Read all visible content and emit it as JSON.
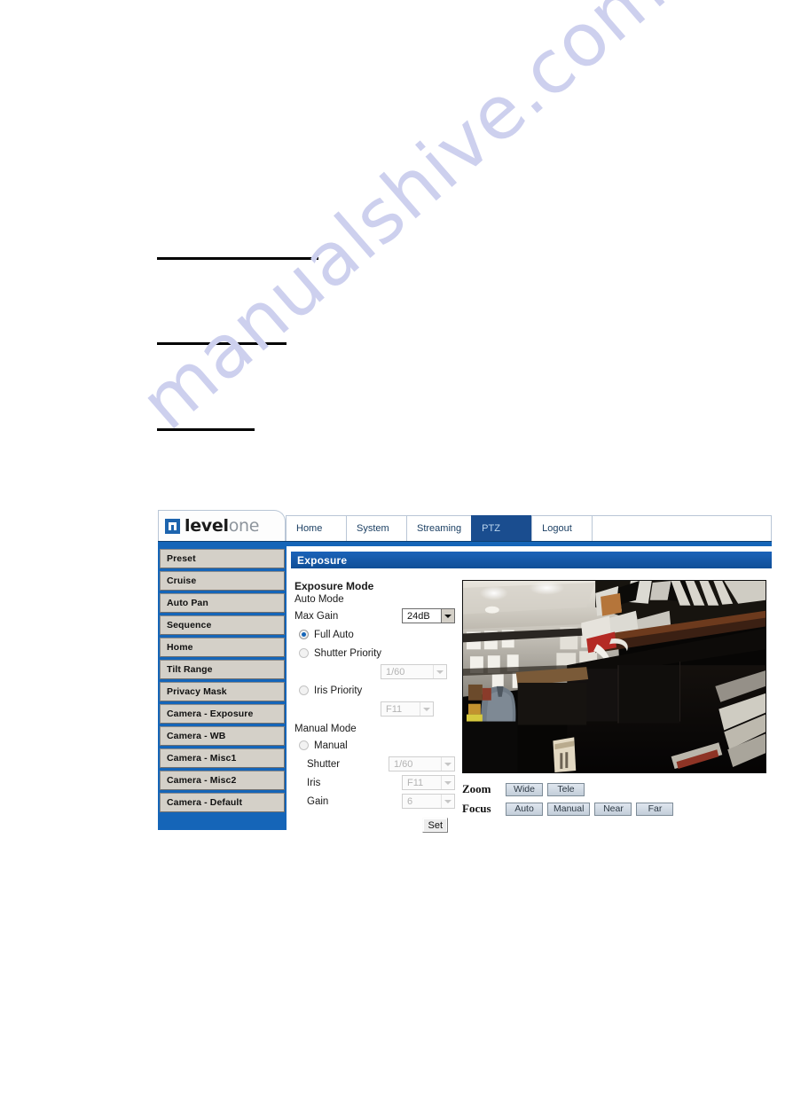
{
  "watermark": {
    "text": "manualshive.com"
  },
  "browser_ui": {
    "logo": {
      "brand_bold": "level",
      "brand_light": "one"
    },
    "tabs": [
      {
        "label": "Home",
        "active": false
      },
      {
        "label": "System",
        "active": false
      },
      {
        "label": "Streaming",
        "active": false
      },
      {
        "label": "PTZ",
        "active": true
      },
      {
        "label": "Logout",
        "active": false
      }
    ],
    "sidebar": {
      "items": [
        {
          "label": "Preset"
        },
        {
          "label": "Cruise"
        },
        {
          "label": "Auto Pan"
        },
        {
          "label": "Sequence"
        },
        {
          "label": "Home"
        },
        {
          "label": "Tilt Range"
        },
        {
          "label": "Privacy Mask"
        },
        {
          "label": "Camera - Exposure"
        },
        {
          "label": "Camera - WB"
        },
        {
          "label": "Camera - Misc1"
        },
        {
          "label": "Camera - Misc2"
        },
        {
          "label": "Camera - Default"
        }
      ]
    },
    "panel": {
      "title": "Exposure",
      "exposure_mode_heading": "Exposure Mode",
      "auto_mode_label": "Auto Mode",
      "max_gain_label": "Max Gain",
      "max_gain_value": "24dB",
      "full_auto_label": "Full Auto",
      "shutter_priority_label": "Shutter Priority",
      "shutter_priority_value": "1/60",
      "iris_priority_label": "Iris Priority",
      "iris_priority_value": "F11",
      "manual_mode_label": "Manual Mode",
      "manual_label": "Manual",
      "shutter_label": "Shutter",
      "shutter_value": "1/60",
      "iris_label": "Iris",
      "iris_value": "F11",
      "gain_label": "Gain",
      "gain_value": "6",
      "set_button": "Set"
    },
    "ptz_controls": {
      "zoom_label": "Zoom",
      "zoom_buttons": [
        "Wide",
        "Tele"
      ],
      "focus_label": "Focus",
      "focus_buttons": [
        "Auto",
        "Manual",
        "Near",
        "Far"
      ]
    },
    "colors": {
      "accent_blue": "#1565b8",
      "tab_active_blue": "#1a4d8f",
      "panel_title_blue": "#1458a8",
      "nav_button_gray": "#d4d0c8",
      "watermark_lavender": "#cdd0ee"
    }
  }
}
